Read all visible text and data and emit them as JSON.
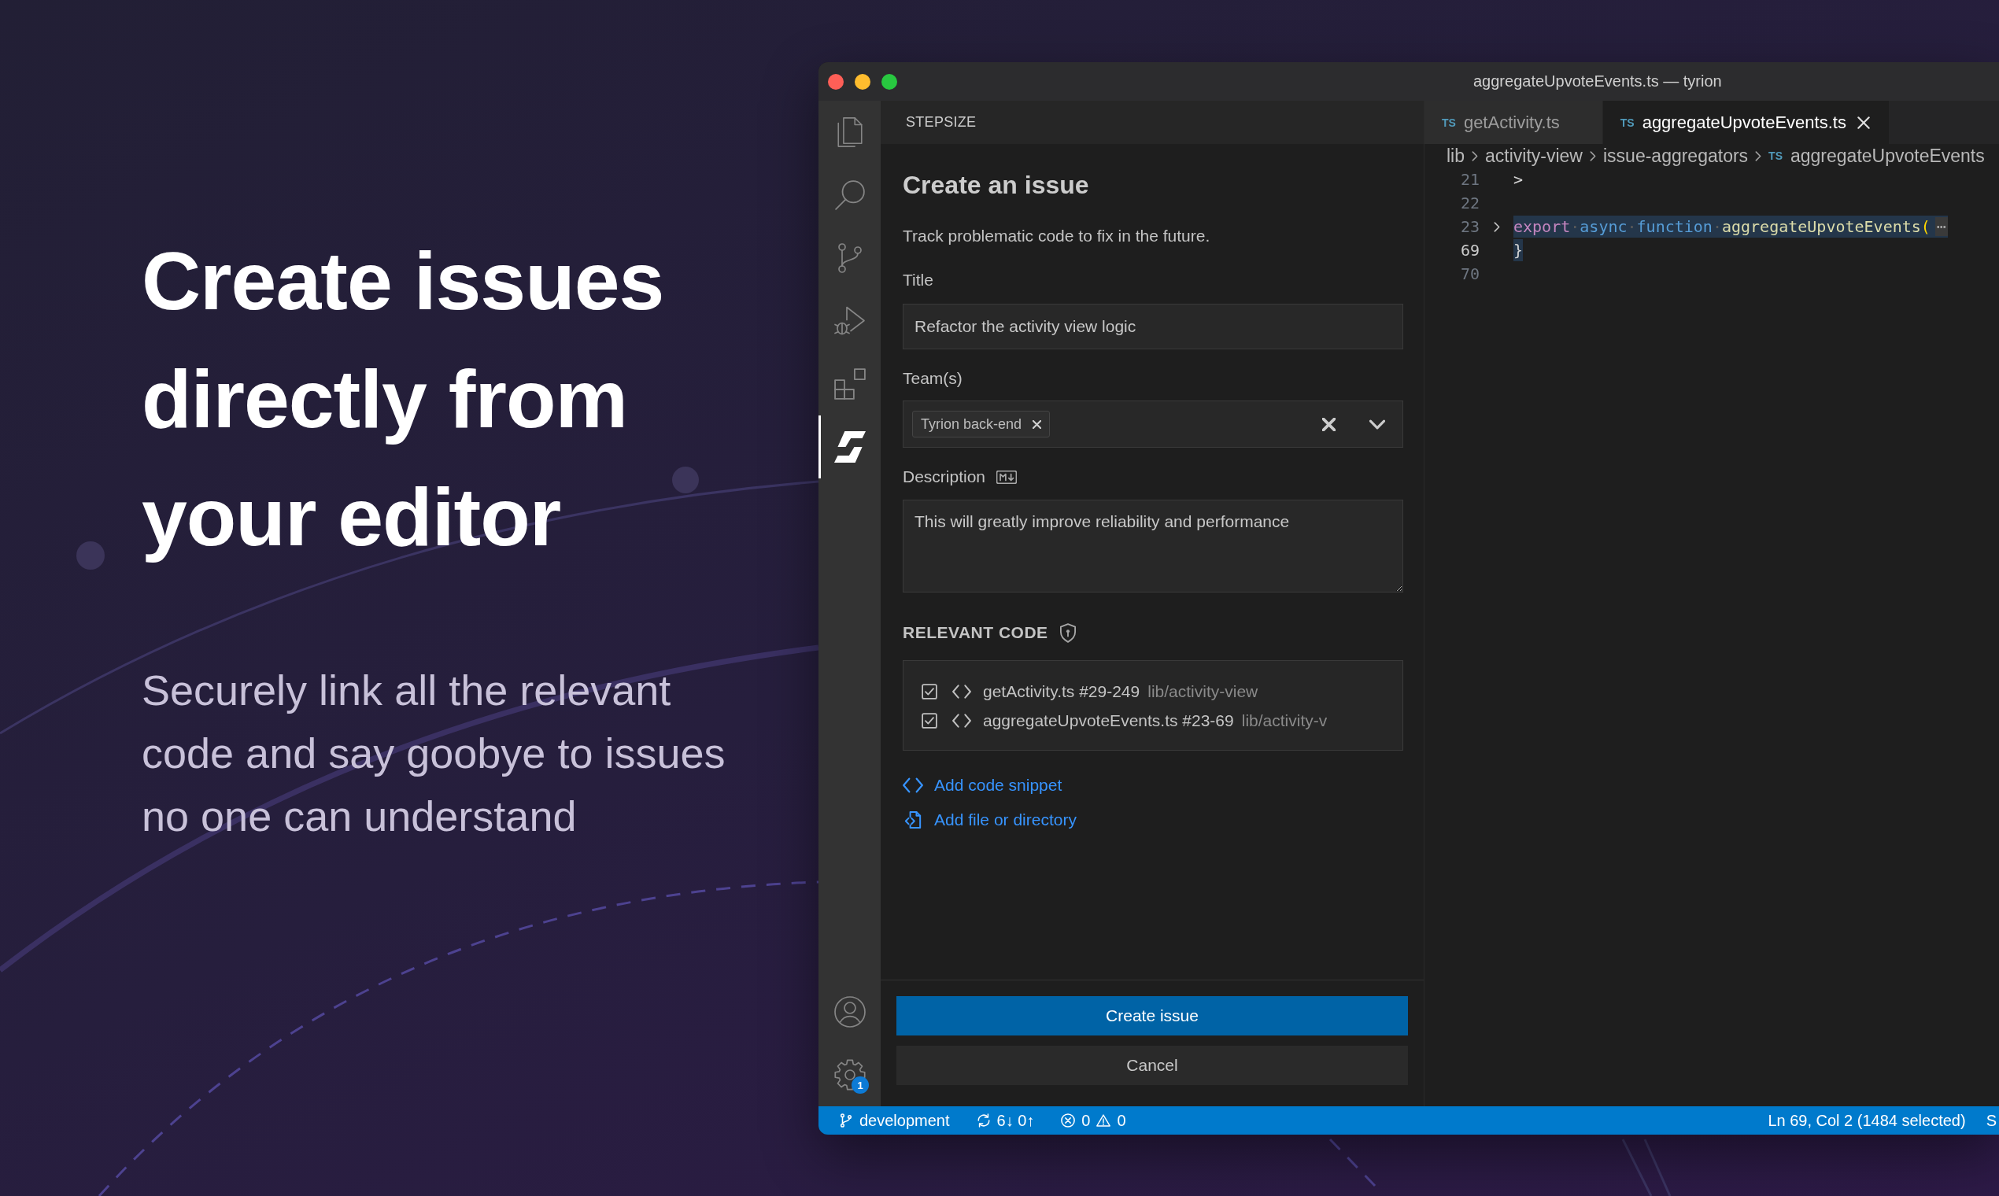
{
  "hero": {
    "headline": "Create issues directly from your editor",
    "subtitle": "Securely link all the relevant code and say goobye to issues no one can understand"
  },
  "window": {
    "title": "aggregateUpvoteEvents.ts — tyrion"
  },
  "activity_bar": {
    "items": [
      {
        "kind": "explorer",
        "selected": false
      },
      {
        "kind": "search",
        "selected": false
      },
      {
        "kind": "source_control",
        "selected": false
      },
      {
        "kind": "run_debug",
        "selected": false
      },
      {
        "kind": "extensions",
        "selected": false
      },
      {
        "kind": "stepsize",
        "selected": true
      }
    ],
    "bottom": [
      {
        "kind": "account"
      },
      {
        "kind": "settings",
        "badge": "1"
      }
    ]
  },
  "side_panel": {
    "header": "STEPSIZE",
    "heading": "Create an issue",
    "intro": "Track problematic code to fix in the future.",
    "title_field": {
      "label": "Title",
      "value": "Refactor the activity view logic"
    },
    "teams_field": {
      "label": "Team(s)",
      "tags": [
        {
          "text": "Tyrion back-end"
        }
      ]
    },
    "description_field": {
      "label": "Description",
      "value": "This will greatly improve reliability and performance"
    },
    "relevant_code": {
      "heading": "RELEVANT CODE",
      "items": [
        {
          "checked": true,
          "file": "getActivity.ts #29-249",
          "path": "lib/activity-view"
        },
        {
          "checked": true,
          "file": "aggregateUpvoteEvents.ts #23-69",
          "path": "lib/activity-v"
        }
      ]
    },
    "links": [
      {
        "kind": "snippet",
        "text": "Add code snippet"
      },
      {
        "kind": "file",
        "text": "Add file or directory"
      }
    ],
    "buttons": [
      {
        "kind": "primary",
        "label": "Create issue"
      },
      {
        "kind": "secondary",
        "label": "Cancel"
      }
    ]
  },
  "editor": {
    "tabs": [
      {
        "badge": "TS",
        "label": "getActivity.ts",
        "selected": false
      },
      {
        "badge": "TS",
        "label": "aggregateUpvoteEvents.ts",
        "selected": true
      }
    ],
    "breadcrumbs": [
      {
        "text": "lib"
      },
      {
        "text": "activity-view"
      },
      {
        "text": "issue-aggregators"
      },
      {
        "badge": "TS",
        "text": "aggregateUpvoteEvents"
      }
    ],
    "lines": [
      {
        "number": "21",
        "current": false,
        "folded": false,
        "selected": false,
        "tokens": [
          {
            "kind": "plain",
            "text": ">"
          }
        ]
      },
      {
        "number": "22",
        "current": false,
        "folded": false
      },
      {
        "number": "23",
        "current": false,
        "folded": true,
        "selected": true,
        "tokens": [
          {
            "kind": "keyword",
            "text": "export"
          },
          {
            "kind": "whitespace",
            "text": "·"
          },
          {
            "kind": "storage",
            "text": "async"
          },
          {
            "kind": "whitespace",
            "text": "·"
          },
          {
            "kind": "storage",
            "text": "function"
          },
          {
            "kind": "whitespace",
            "text": "·"
          },
          {
            "kind": "function",
            "text": "aggregateUpvoteEvents"
          },
          {
            "kind": "bracket",
            "text": "("
          },
          {
            "kind": "fold",
            "text": "⋯"
          }
        ]
      },
      {
        "number": "69",
        "current": true,
        "folded": false,
        "selected": true,
        "tokens": [
          {
            "kind": "punctuation",
            "text": "}"
          }
        ]
      },
      {
        "number": "70",
        "current": false,
        "folded": false
      }
    ]
  },
  "status_bar": {
    "left": [
      {
        "kind": "branch",
        "text": "development"
      },
      {
        "kind": "sync",
        "text": "6↓ 0↑"
      },
      {
        "kind": "problems",
        "errors": "0",
        "warnings": "0"
      }
    ],
    "right": [
      {
        "text": "Ln 69, Col 2 (1484 selected)"
      },
      {
        "text": "S"
      }
    ]
  }
}
